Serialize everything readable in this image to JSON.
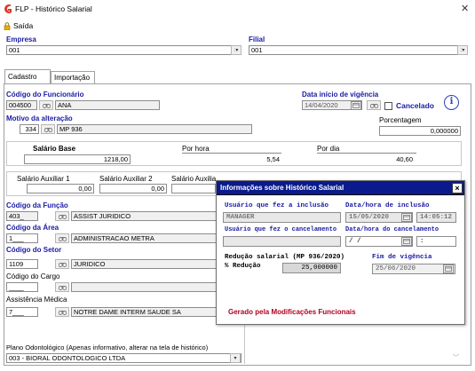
{
  "window": {
    "title": "FLP - Histórico Salarial"
  },
  "menu": {
    "saida": "Saída"
  },
  "empresa": {
    "label": "Empresa",
    "value": "001"
  },
  "filial": {
    "label": "Filial",
    "value": "001"
  },
  "tabs": [
    {
      "label": "Cadastro"
    },
    {
      "label": "Importação"
    }
  ],
  "funcionario": {
    "label": "Código do Funcionário",
    "code": "004500",
    "name": "ANA"
  },
  "vigencia": {
    "label": "Data início de vigência",
    "date": "14/04/2020",
    "cancelado_label": "Cancelado"
  },
  "motivo": {
    "label": "Motivo da alteração",
    "code": "334",
    "desc": "MP 936"
  },
  "porcentagem": {
    "label": "Porcentagem",
    "value": "0,000000"
  },
  "salario": {
    "base_label": "Salário Base",
    "base_value": "1218,00",
    "hora_label": "Por hora",
    "hora_value": "5,54",
    "dia_label": "Por dia",
    "dia_value": "40,60"
  },
  "auxiliares": {
    "aux1_label": "Salário Auxiliar 1",
    "aux1_value": "0,00",
    "aux2_label": "Salário Auxiliar 2",
    "aux2_value": "0,00",
    "aux3_label": "Salário Auxiliar 3"
  },
  "funcao": {
    "label": "Código da Função",
    "code": "403_",
    "desc": "ASSIST JURIDICO"
  },
  "area": {
    "label": "Código da Área",
    "code": "1___",
    "desc": "ADMINISTRACAO METRA"
  },
  "setor": {
    "label": "Código do Setor",
    "code": "1109",
    "desc": "JURIDICO"
  },
  "cargo": {
    "label": "Código do Cargo",
    "code": "____"
  },
  "medica": {
    "label": "Assistência Médica",
    "code": "7___",
    "desc": "NOTRE DAME INTERM SAUDE SA"
  },
  "odonto": {
    "label": "Plano Odontológico (Apenas informativo, alterar na tela de histórico)",
    "value": "003 - BIORAL ODONTOLOGICO LTDA"
  },
  "dialog": {
    "title": "Informações sobre Histórico Salarial",
    "usuario_inclusao_label": "Usuário que fez a inclusão",
    "usuario_inclusao": "MANAGER",
    "data_inclusao_label": "Data/hora de inclusão",
    "data_inclusao": "15/05/2020",
    "hora_inclusao": "14:05:12",
    "usuario_cancel_label": "Usuário que fez o cancelamento",
    "data_cancel_label": "Data/hora do cancelamento",
    "data_cancel": " / /",
    "hora_cancel": " :",
    "reducao_title": "Redução salarial (MP 936/2020)",
    "reducao_label": "% Redução",
    "reducao_value": "25,000000",
    "fim_label": "Fim de vigência",
    "fim_value": "25/06/2020",
    "footer": "Gerado pela Modificações Funcionais"
  },
  "colors": {
    "label_blue": "#1a1aa6",
    "footer_red": "#b00020",
    "app_icon_red": "#d83b2b"
  }
}
